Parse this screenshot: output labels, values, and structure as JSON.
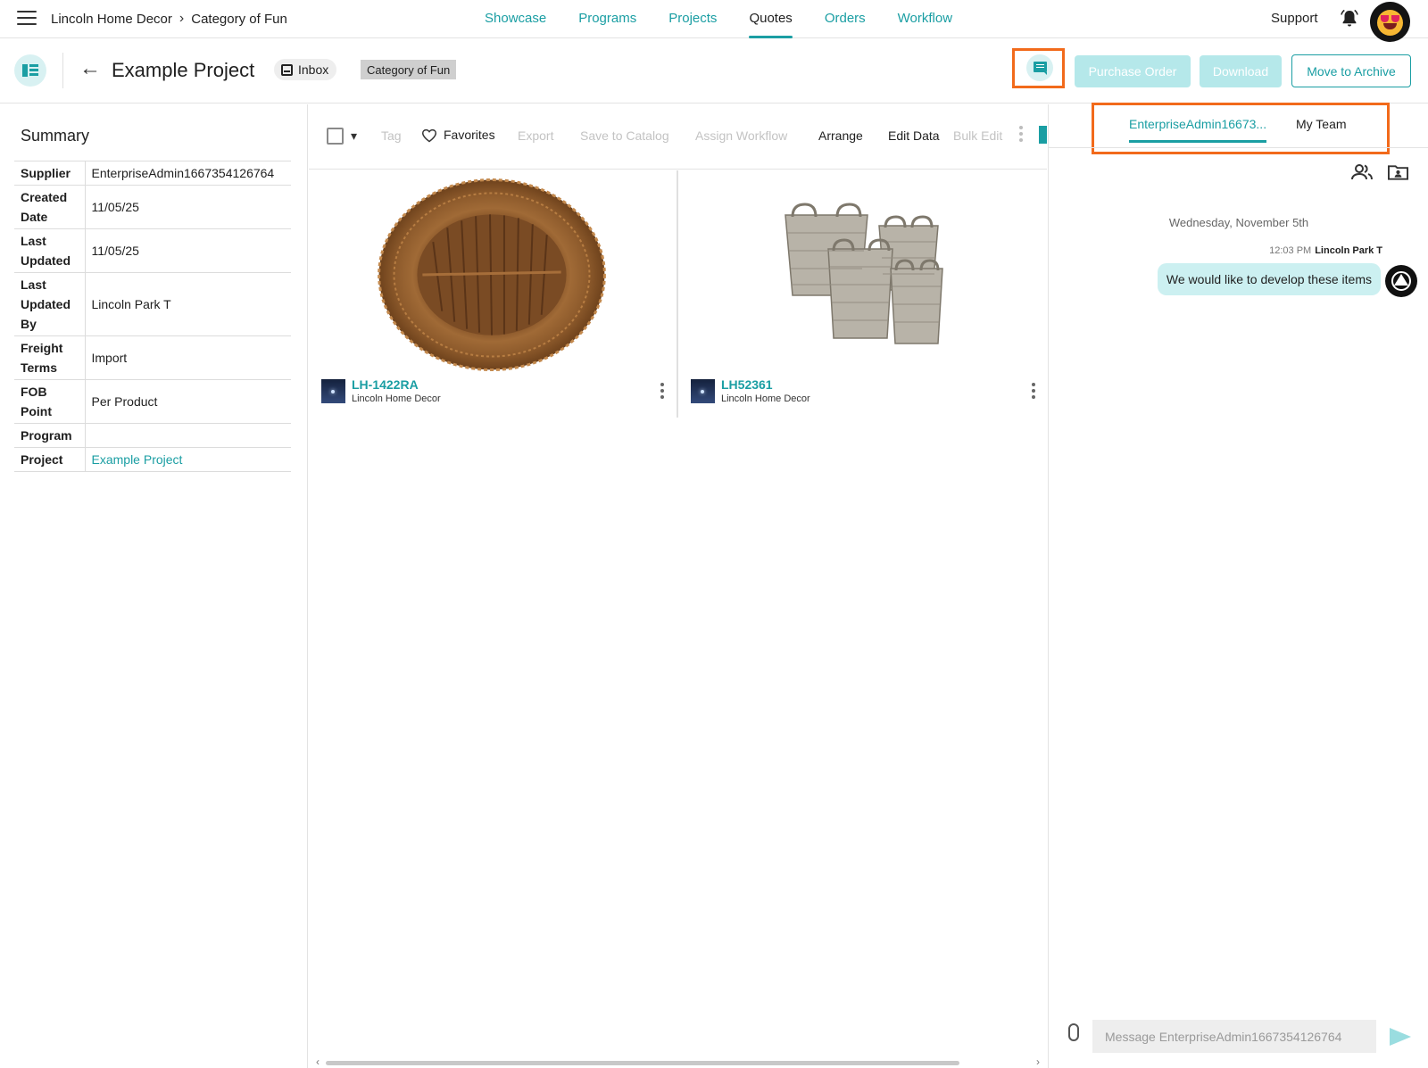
{
  "topnav": {
    "breadcrumb": [
      "Lincoln Home Decor",
      "Category of Fun"
    ],
    "links": [
      {
        "label": "Showcase",
        "active": false
      },
      {
        "label": "Programs",
        "active": false
      },
      {
        "label": "Projects",
        "active": false
      },
      {
        "label": "Quotes",
        "active": true
      },
      {
        "label": "Orders",
        "active": false
      },
      {
        "label": "Workflow",
        "active": false
      }
    ],
    "support": "Support",
    "icons": [
      "menu-icon",
      "bell-icon",
      "user-avatar"
    ]
  },
  "header": {
    "title": "Example Project",
    "inbox": "Inbox",
    "category_tag": "Category of Fun",
    "buttons": {
      "purchase_order": "Purchase Order",
      "download": "Download",
      "move_to_archive": "Move to Archive"
    }
  },
  "summary": {
    "heading": "Summary",
    "rows": [
      {
        "key": "Supplier",
        "value": "EnterpriseAdmin1667354126764"
      },
      {
        "key": "Created Date",
        "value": "11/05/25"
      },
      {
        "key": "Last Updated",
        "value": "11/05/25"
      },
      {
        "key": "Last Updated By",
        "value": "Lincoln Park T"
      },
      {
        "key": "Freight Terms",
        "value": "Import"
      },
      {
        "key": "FOB Point",
        "value": "Per Product"
      },
      {
        "key": "Program",
        "value": ""
      },
      {
        "key": "Project",
        "value": "Example Project"
      }
    ]
  },
  "toolbar": {
    "tag": "Tag",
    "favorites": "Favorites",
    "export": "Export",
    "save_to_catalog": "Save to Catalog",
    "assign_workflow": "Assign Workflow",
    "arrange": "Arrange",
    "edit_data": "Edit Data",
    "bulk_edit": "Bulk Edit"
  },
  "products": [
    {
      "sku": "LH-1422RA",
      "vendor": "Lincoln Home Decor",
      "image": "round woven rattan charger tray"
    },
    {
      "sku": "LH52361",
      "vendor": "Lincoln Home Decor",
      "image": "set of four grey wicker baskets"
    }
  ],
  "chat": {
    "tabs": [
      "EnterpriseAdmin16673...",
      "My Team"
    ],
    "day": "Wednesday, November 5th",
    "time": "12:03 PM",
    "author": "Lincoln Park T",
    "message": "We would like to develop these items",
    "input_placeholder": "Message EnterpriseAdmin1667354126764"
  },
  "colors": {
    "accent": "#1a9ea3",
    "accent_light": "#ccf0f1",
    "highlight": "#f26a1b",
    "disabled_button": "#b5e8ea"
  }
}
